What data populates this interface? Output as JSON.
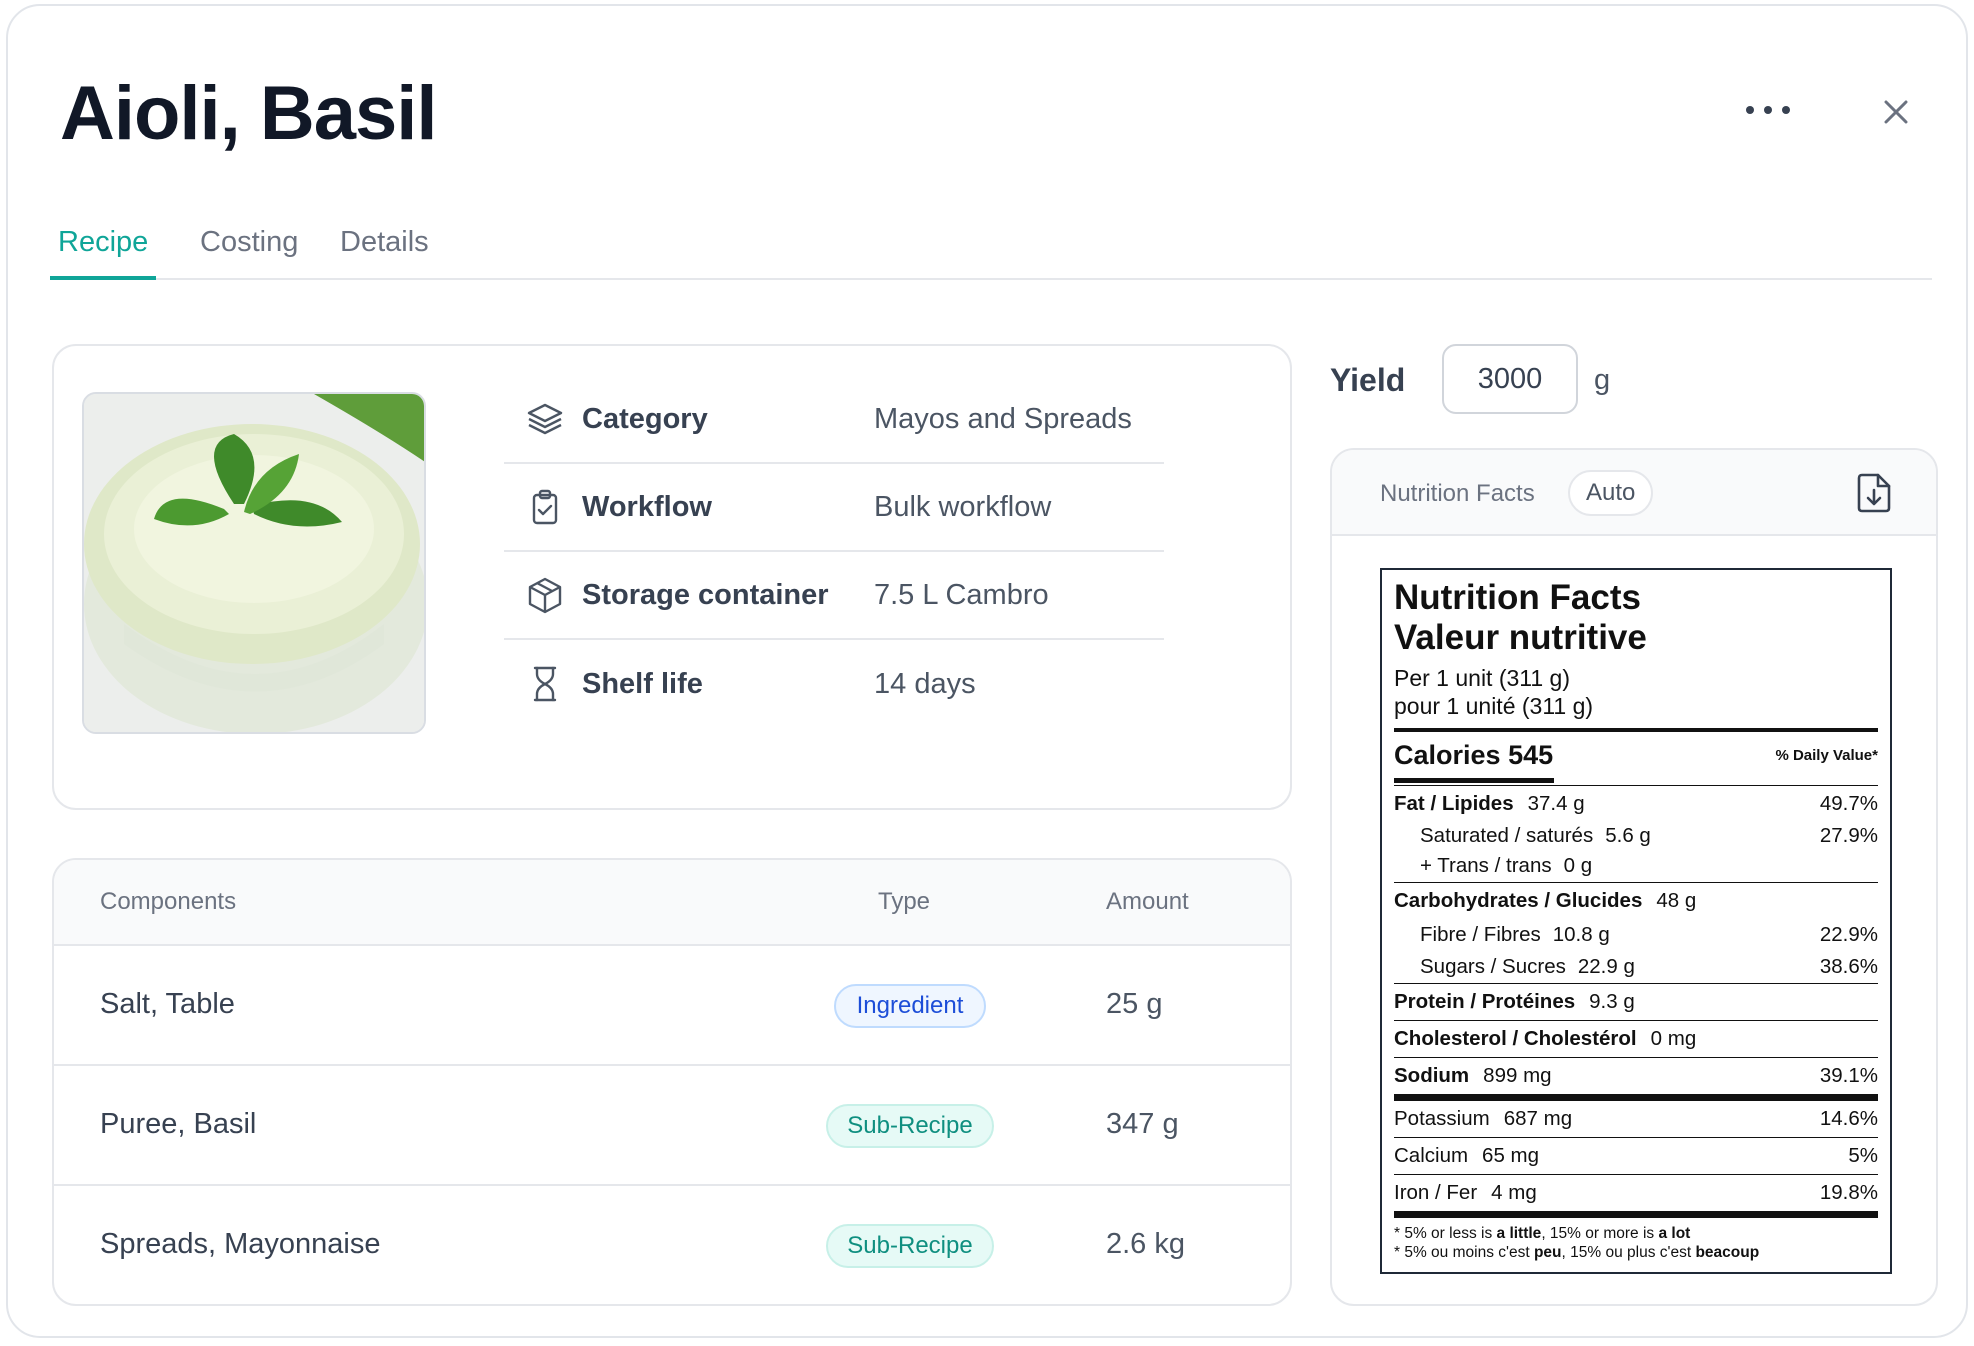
{
  "title": "Aioli, Basil",
  "tabs": [
    {
      "label": "Recipe",
      "active": true
    },
    {
      "label": "Costing",
      "active": false
    },
    {
      "label": "Details",
      "active": false
    }
  ],
  "info": [
    {
      "icon": "layers-icon",
      "label": "Category",
      "value": "Mayos and Spreads"
    },
    {
      "icon": "clipboard-check-icon",
      "label": "Workflow",
      "value": "Bulk workflow"
    },
    {
      "icon": "box-icon",
      "label": "Storage container",
      "value": "7.5 L Cambro"
    },
    {
      "icon": "hourglass-icon",
      "label": "Shelf life",
      "value": "14 days"
    }
  ],
  "components": {
    "headers": {
      "name": "Components",
      "type": "Type",
      "amount": "Amount"
    },
    "rows": [
      {
        "name": "Salt, Table",
        "type": "Ingredient",
        "amount": "25 g"
      },
      {
        "name": "Puree, Basil",
        "type": "Sub-Recipe",
        "amount": "347 g"
      },
      {
        "name": "Spreads, Mayonnaise",
        "type": "Sub-Recipe",
        "amount": "2.6 kg"
      }
    ]
  },
  "yield": {
    "label": "Yield",
    "value": "3000",
    "unit": "g"
  },
  "nutrition_panel": {
    "title": "Nutrition Facts",
    "mode": "Auto"
  },
  "nutrition_label": {
    "title_en": "Nutrition Facts",
    "title_fr": "Valeur nutritive",
    "per_en": "Per 1 unit (311 g)",
    "per_fr": "pour 1 unité (311 g)",
    "calories_label": "Calories",
    "calories": "545",
    "dv_header": "% Daily Value*",
    "fat": {
      "label": "Fat / Lipides",
      "qty": "37.4 g",
      "pct": "49.7%"
    },
    "saturated": {
      "label": "Saturated / saturés",
      "qty": "5.6 g"
    },
    "trans": {
      "label": "+ Trans / trans",
      "qty": "0 g"
    },
    "sat_trans_pct": "27.9%",
    "carbs": {
      "label": "Carbohydrates / Glucides",
      "qty": "48 g"
    },
    "fibre": {
      "label": "Fibre / Fibres",
      "qty": "10.8 g",
      "pct": "22.9%"
    },
    "sugars": {
      "label": "Sugars / Sucres",
      "qty": "22.9 g",
      "pct": "38.6%"
    },
    "protein": {
      "label": "Protein / Protéines",
      "qty": "9.3 g"
    },
    "cholesterol": {
      "label": "Cholesterol / Cholestérol",
      "qty": "0 mg"
    },
    "sodium": {
      "label": "Sodium",
      "qty": "899 mg",
      "pct": "39.1%"
    },
    "potassium": {
      "label": "Potassium",
      "qty": "687 mg",
      "pct": "14.6%"
    },
    "calcium": {
      "label": "Calcium",
      "qty": "65 mg",
      "pct": "5%"
    },
    "iron": {
      "label": "Iron / Fer",
      "qty": "4 mg",
      "pct": "19.8%"
    },
    "foot_en": {
      "pre": "* 5% or less is ",
      "b1": "a little",
      "mid": ", 15% or more is ",
      "b2": "a lot"
    },
    "foot_fr": {
      "pre": "* 5% ou moins c'est ",
      "b1": "peu",
      "mid": ", 15% ou plus c'est ",
      "b2": "beacoup"
    }
  },
  "colors": {
    "accent": "#0fa598",
    "ingredient_badge": "#1d4ed8",
    "subrecipe_badge": "#0f8f80"
  }
}
